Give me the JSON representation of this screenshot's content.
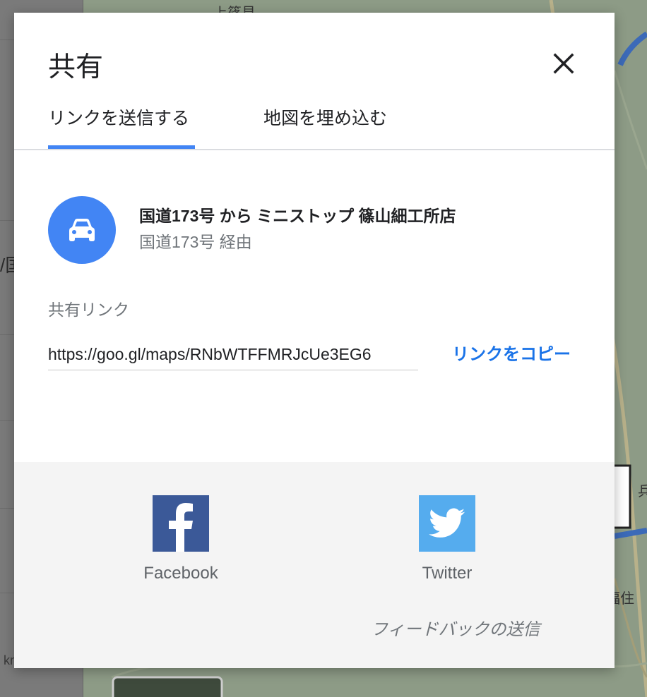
{
  "background": {
    "map_labels": [
      "上篠見",
      "兵",
      "福住"
    ],
    "panel_glyphs": [
      "/国"
    ],
    "scale_text": "km"
  },
  "dialog": {
    "title": "共有",
    "close_icon": "close-icon",
    "tabs": [
      {
        "label": "リンクを送信する",
        "selected": true
      },
      {
        "label": "地図を埋め込む",
        "selected": false
      }
    ],
    "route": {
      "icon": "car-icon",
      "title": "国道173号 から ミニストップ 篠山細工所店",
      "subtitle": "国道173号 経由"
    },
    "share_link": {
      "label": "共有リンク",
      "value": "https://goo.gl/maps/RNbWTFFMRJcUe3EG6",
      "copy_label": "リンクをコピー"
    },
    "social": [
      {
        "name": "Facebook",
        "icon": "facebook-icon"
      },
      {
        "name": "Twitter",
        "icon": "twitter-icon"
      }
    ],
    "feedback_label": "フィードバックの送信"
  },
  "colors": {
    "accent_blue": "#4285f4",
    "link_blue": "#1a73e8",
    "facebook": "#3b5998",
    "twitter": "#55acee",
    "footer_bg": "#f4f4f4"
  }
}
